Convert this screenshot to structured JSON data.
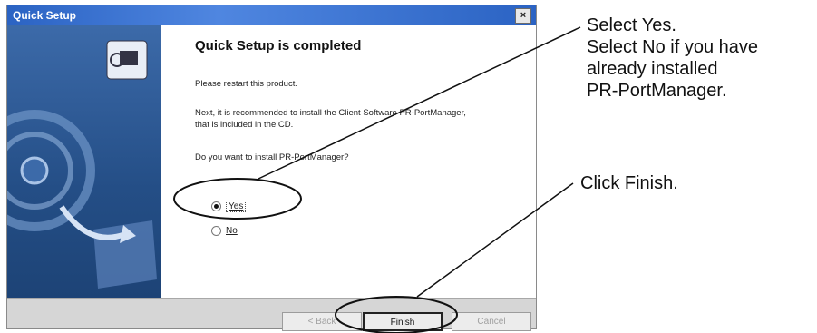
{
  "window": {
    "title": "Quick Setup",
    "close_label": "×"
  },
  "content": {
    "heading": "Quick Setup is completed",
    "line1": "Please restart this product.",
    "line2a": "Next, it is recommended to install the Client Software PR-PortManager,",
    "line2b": "that is included in the CD.",
    "question": "Do you want to install PR-PortManager?",
    "options": [
      {
        "label": "Yes",
        "checked": true
      },
      {
        "label": "No",
        "checked": false
      }
    ]
  },
  "buttons": {
    "back": "< Back",
    "finish": "Finish",
    "cancel": "Cancel"
  },
  "annotations": {
    "select_yes": "Select Yes.",
    "select_no_1": "Select No if you have",
    "select_no_2": "already installed",
    "select_no_3": "PR-PortManager.",
    "click_finish": "Click Finish."
  }
}
